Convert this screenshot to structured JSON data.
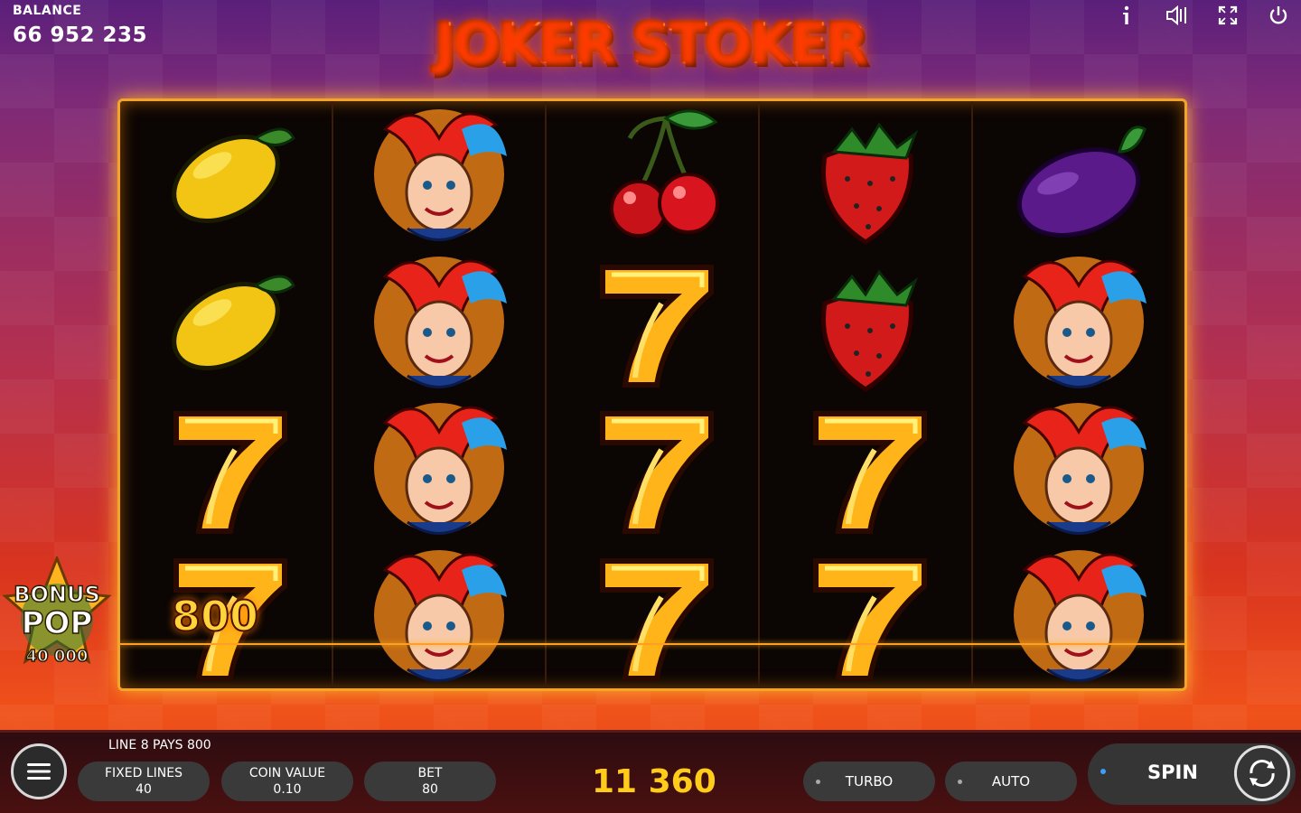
{
  "balance": {
    "label": "BALANCE",
    "value": "66 952 235"
  },
  "game_title": "JOKER STOKER",
  "top_icons": [
    "info-icon",
    "sound-icon",
    "fullscreen-icon",
    "power-icon"
  ],
  "reels": [
    [
      "lemon",
      "lemon",
      "seven",
      "seven"
    ],
    [
      "joker",
      "joker",
      "joker",
      "joker"
    ],
    [
      "cherry",
      "seven",
      "seven",
      "seven"
    ],
    [
      "strawberry",
      "strawberry",
      "seven",
      "seven"
    ],
    [
      "plum",
      "joker",
      "joker",
      "joker"
    ]
  ],
  "win_on_reel": "800",
  "bonus": {
    "line1": "BONUS",
    "line2": "POP",
    "value": "40 000"
  },
  "bottom": {
    "line_info": "LINE 8 PAYS 800",
    "fixed_lines": {
      "label": "FIXED LINES",
      "value": "40"
    },
    "coin_value": {
      "label": "COIN VALUE",
      "value": "0.10"
    },
    "bet": {
      "label": "BET",
      "value": "80"
    },
    "win_total": "11 360",
    "turbo_label": "TURBO",
    "auto_label": "AUTO",
    "spin_label": "SPIN"
  },
  "colors": {
    "frame": "#f3a52a",
    "win": "#ffcc1a",
    "accent_dot": "#3aa0ff"
  }
}
